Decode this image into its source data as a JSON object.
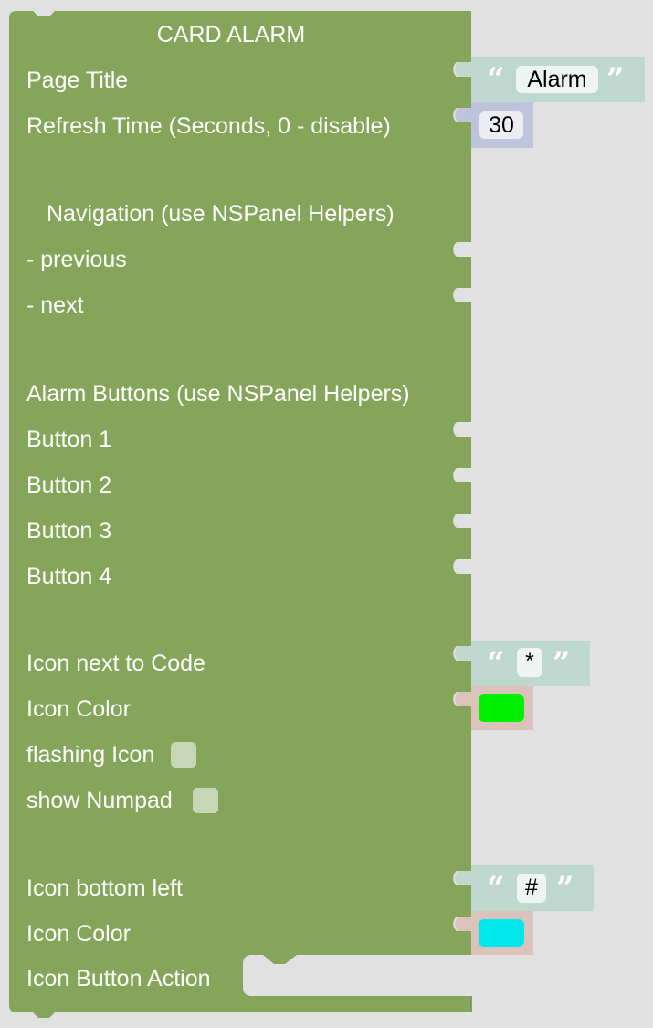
{
  "block": {
    "title": "CARD ALARM",
    "colors": {
      "block": "#85a65a",
      "block_dark": "#6b8a44",
      "text_block": "#bed8cf",
      "number_block": "#c0c3dc",
      "colour_block": "#dbc3bb"
    }
  },
  "inputs": {
    "page_title_label": "Page Title",
    "page_title_value": "Alarm",
    "refresh_label": "Refresh Time (Seconds, 0 - disable)",
    "refresh_value": "30",
    "navigation_heading": "Navigation (use NSPanel Helpers)",
    "previous_label": "- previous",
    "next_label": "- next",
    "alarm_buttons_heading": "Alarm Buttons (use NSPanel Helpers)",
    "buttons": [
      "Button 1",
      "Button 2",
      "Button 3",
      "Button 4"
    ],
    "icon_next_to_code_label": "Icon next to Code",
    "icon_next_to_code_value": "*",
    "icon_color_label_1": "Icon Color",
    "icon_color_1": "#00f000",
    "flashing_icon_label": "flashing Icon",
    "flashing_icon_checked": false,
    "show_numpad_label": "show Numpad",
    "show_numpad_checked": false,
    "icon_bottom_left_label": "Icon bottom left",
    "icon_bottom_left_value": "#",
    "icon_color_label_2": "Icon Color",
    "icon_color_2": "#00e8ec",
    "icon_button_action_label": "Icon Button Action"
  }
}
